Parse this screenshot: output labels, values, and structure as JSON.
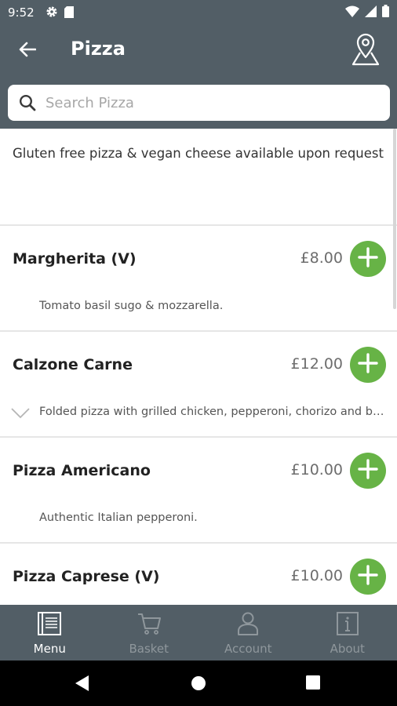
{
  "status_bar": {
    "time": "9:52"
  },
  "app_bar": {
    "title": "Pizza"
  },
  "search": {
    "placeholder": "Search Pizza",
    "value": ""
  },
  "notice": "Gluten free pizza & vegan cheese available upon request",
  "items": [
    {
      "name": "Margherita (V)",
      "price": "£8.00",
      "description": "Tomato basil sugo & mozzarella.",
      "expandable": false
    },
    {
      "name": "Calzone Carne",
      "price": "£12.00",
      "description": "Folded pizza with grilled chicken, pepperoni, chorizo and beef",
      "expandable": true
    },
    {
      "name": "Pizza Americano",
      "price": "£10.00",
      "description": "Authentic Italian pepperoni.",
      "expandable": false
    },
    {
      "name": "Pizza Caprese (V)",
      "price": "£10.00",
      "description": "",
      "expandable": false
    }
  ],
  "bottom_nav": [
    {
      "label": "Menu",
      "icon": "menu-book-icon",
      "active": true
    },
    {
      "label": "Basket",
      "icon": "cart-icon",
      "active": false
    },
    {
      "label": "Account",
      "icon": "person-icon",
      "active": false
    },
    {
      "label": "About",
      "icon": "info-icon",
      "active": false
    }
  ],
  "colors": {
    "header": "#525e66",
    "accent_green": "#67b346",
    "inactive_nav": "#8f979c"
  }
}
